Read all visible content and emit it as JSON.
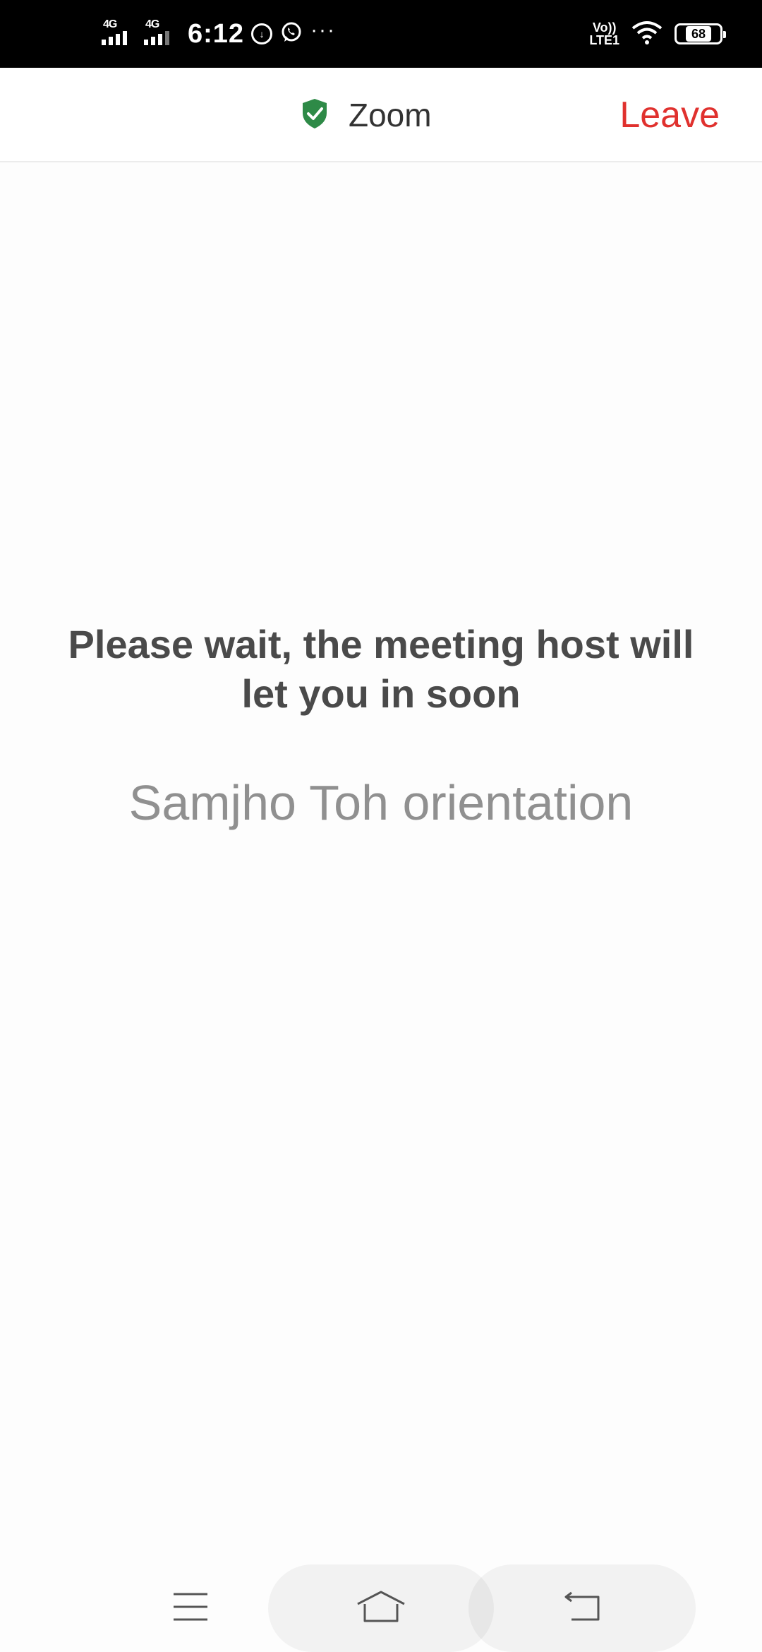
{
  "status_bar": {
    "network_1": "4G",
    "network_2": "4G",
    "time": "6:12",
    "volte": "Vo))",
    "lte": "LTE1",
    "battery": "68"
  },
  "header": {
    "title": "Zoom",
    "leave_label": "Leave",
    "shield_icon": "shield-check-icon",
    "shield_color": "#2e8a47",
    "leave_color": "#e0312e"
  },
  "main": {
    "wait_message": "Please wait, the meeting host will let you in soon",
    "meeting_name": "Samjho Toh orientation"
  },
  "nav_bar": {
    "menu_icon": "menu-icon",
    "home_icon": "home-icon",
    "back_icon": "back-icon"
  }
}
